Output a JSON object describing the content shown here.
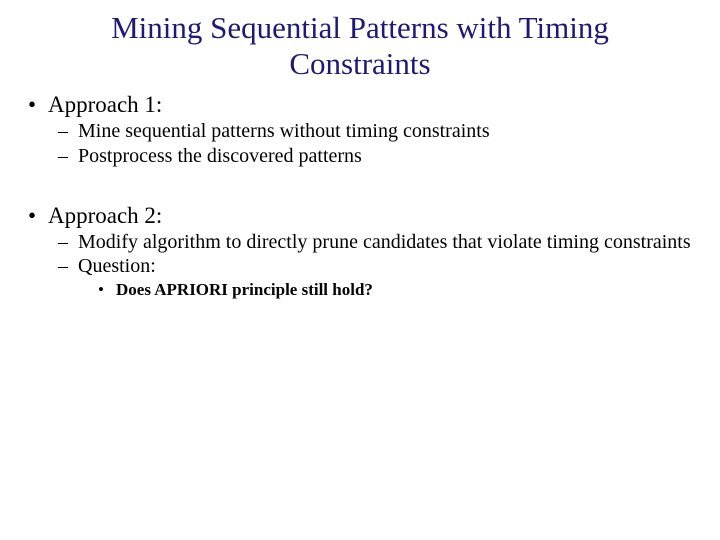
{
  "title": "Mining Sequential Patterns with Timing Constraints",
  "approach1": {
    "heading": "Approach 1:",
    "sub1": "Mine sequential patterns without timing constraints",
    "sub2": "Postprocess the discovered patterns"
  },
  "approach2": {
    "heading": "Approach 2:",
    "sub1": "Modify algorithm to directly prune candidates that violate timing constraints",
    "sub2": "Question:",
    "sub2a": "Does APRIORI principle still hold?"
  }
}
